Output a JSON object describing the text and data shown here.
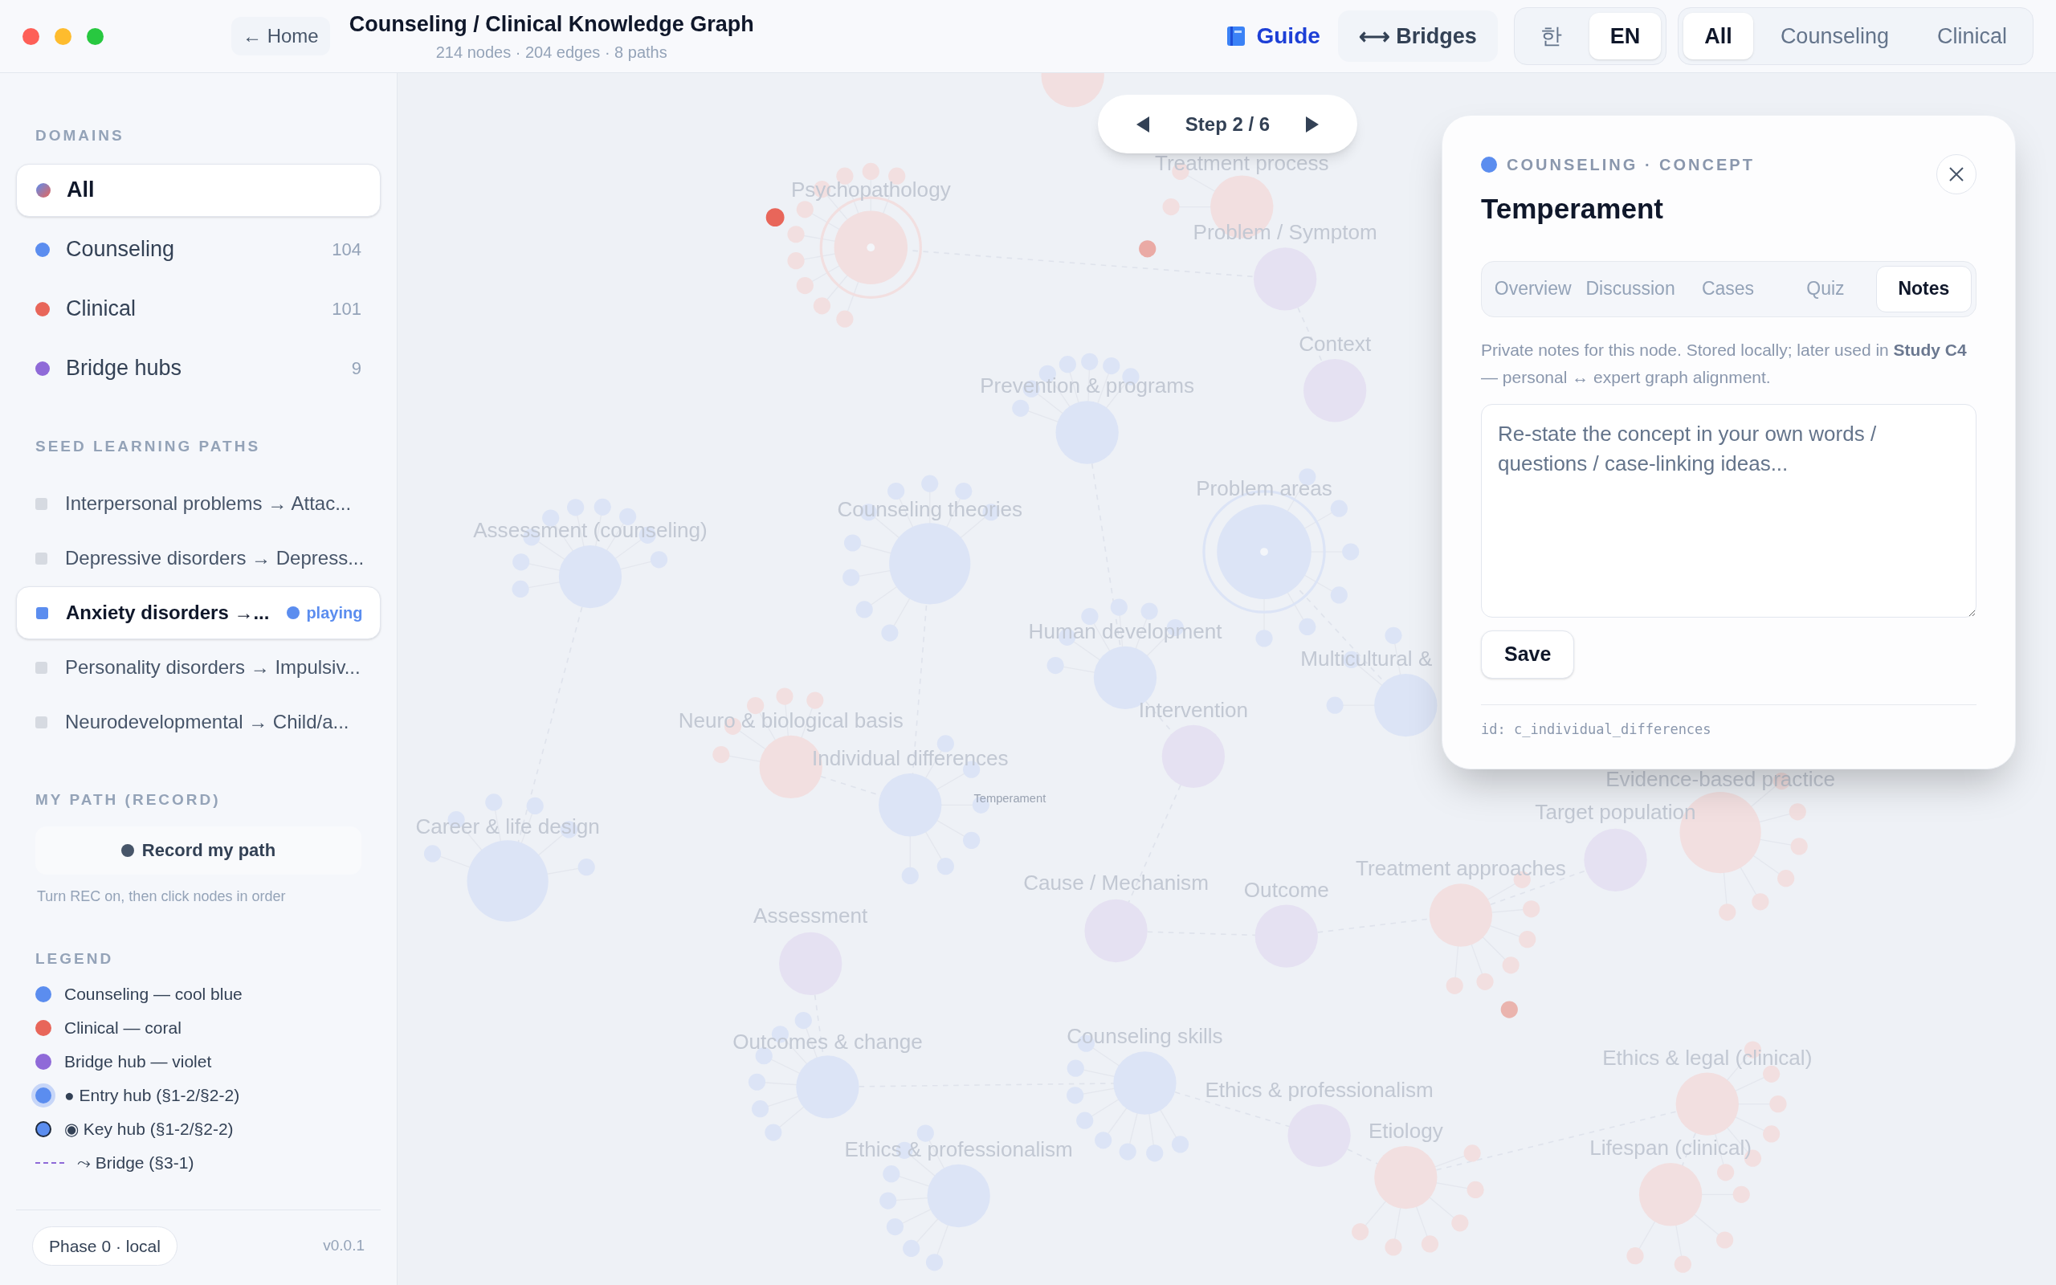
{
  "window": {
    "title": "Counseling / Clinical Knowledge Graph",
    "subtitle": "214 nodes · 204 edges · 8 paths"
  },
  "top_bar": {
    "home": "← Home",
    "guide": "Guide",
    "bridges": "⟷ Bridges",
    "languages": [
      {
        "label": "한",
        "selected": false
      },
      {
        "label": "EN",
        "selected": true
      }
    ],
    "filters": [
      {
        "label": "All",
        "selected": true
      },
      {
        "label": "Counseling",
        "selected": false
      },
      {
        "label": "Clinical",
        "selected": false
      }
    ]
  },
  "sidebar": {
    "domains_heading": "DOMAINS",
    "domains": [
      {
        "label": "All",
        "selected": true
      },
      {
        "label": "Counseling",
        "count": "104",
        "color": "#5b8def",
        "selected": false
      },
      {
        "label": "Clinical",
        "count": "101",
        "color": "#e8665a",
        "selected": false
      },
      {
        "label": "Bridge hubs",
        "count": "9",
        "color": "#8f6ad8",
        "selected": false
      }
    ],
    "paths_heading": "SEED LEARNING PATHS",
    "paths": [
      {
        "label": "Interpersonal problems → Attac...",
        "selected": false
      },
      {
        "label": "Depressive disorders → Depress...",
        "selected": false
      },
      {
        "label": "Anxiety disorders →...",
        "selected": true,
        "badge": "playing"
      },
      {
        "label": "Personality disorders → Impulsiv...",
        "selected": false
      },
      {
        "label": "Neurodevelopmental → Child/a...",
        "selected": false
      }
    ],
    "record_heading": "MY PATH (RECORD)",
    "record_button": "Record my path",
    "record_hint": "Turn REC on, then click nodes in order",
    "legend_heading": "LEGEND",
    "legend": [
      {
        "kind": "dot",
        "color": "#5b8def",
        "label": "Counseling — cool blue"
      },
      {
        "kind": "dot",
        "color": "#e8665a",
        "label": "Clinical — coral"
      },
      {
        "kind": "dot",
        "color": "#8f6ad8",
        "label": "Bridge hub — violet"
      },
      {
        "kind": "entry",
        "color": "#5b8def",
        "label": "● Entry hub (§1-2/§2-2)"
      },
      {
        "kind": "key",
        "color": "#5b8def",
        "label": "◉ Key hub (§1-2/§2-2)"
      },
      {
        "kind": "dashed",
        "color": "#8f6ad8",
        "label": "⤳ Bridge (§3-1)"
      }
    ],
    "phase": "Phase 0 · local",
    "version": "v0.0.1"
  },
  "graph": {
    "step": "Step 2 / 6",
    "nodes": [
      {
        "kind": "ring",
        "color": "#f2dfe0",
        "label": "Psychopathology"
      },
      {
        "kind": "hub",
        "color": "#f2dfe0",
        "label": "Treatment process"
      },
      {
        "kind": "hub",
        "color": "#e5e1f2",
        "label": "Problem / Symptom"
      },
      {
        "kind": "hub",
        "color": "#e5e1f2",
        "label": "Context"
      },
      {
        "kind": "hub",
        "color": "#dce4f6",
        "label": "Prevention & programs"
      },
      {
        "kind": "hub",
        "color": "#dce4f6",
        "label": "Assessment (counseling)"
      },
      {
        "kind": "hub",
        "color": "#dce4f6",
        "label": "Counseling theories"
      },
      {
        "kind": "ring",
        "color": "#dce4f6",
        "label": "Problem areas"
      },
      {
        "kind": "hub",
        "color": "#dce4f6",
        "label": "Human development"
      },
      {
        "kind": "hub",
        "color": "#dce4f6",
        "label": "Multicultural &"
      },
      {
        "kind": "hub",
        "color": "#e5e1f2",
        "label": "Intervention"
      },
      {
        "kind": "hub",
        "color": "#f2dfe0",
        "label": "Neuro & biological basis"
      },
      {
        "kind": "hub",
        "color": "#dce4f6",
        "label": "Individual differences"
      },
      {
        "kind": "label",
        "label": "Temperament"
      },
      {
        "kind": "hub",
        "color": "#dce4f6",
        "label": "Career & life design"
      },
      {
        "kind": "hub",
        "color": "#e5e1f2",
        "label": "Assessment"
      },
      {
        "kind": "hub",
        "color": "#e5e1f2",
        "label": "Cause / Mechanism"
      },
      {
        "kind": "hub",
        "color": "#e5e1f2",
        "label": "Outcome"
      },
      {
        "kind": "hub",
        "color": "#f2dfe0",
        "label": "Treatment approaches"
      },
      {
        "kind": "hub",
        "color": "#e5e1f2",
        "label": "Target population"
      },
      {
        "kind": "hub",
        "color": "#f2dfe0",
        "label": "Evidence-based practice"
      },
      {
        "kind": "hub",
        "color": "#dce4f6",
        "label": "Outcomes & change"
      },
      {
        "kind": "hub",
        "color": "#dce4f6",
        "label": "Counseling skills"
      },
      {
        "kind": "hub",
        "color": "#e5e1f2",
        "label": "Ethics & professionalism"
      },
      {
        "kind": "hub",
        "color": "#f2dfe0",
        "label": "Etiology"
      },
      {
        "kind": "hub",
        "color": "#f2dfe0",
        "label": "Ethics & legal (clinical)"
      },
      {
        "kind": "hub",
        "color": "#f2dfe0",
        "label": "Lifespan (clinical)"
      },
      {
        "kind": "hub",
        "color": "#dce4f6",
        "label": "Ethics & professionalism"
      }
    ]
  },
  "panel": {
    "meta": "COUNSELING · CONCEPT",
    "color": "#5b8def",
    "title": "Temperament",
    "tabs": [
      {
        "label": "Overview",
        "selected": false
      },
      {
        "label": "Discussion",
        "selected": false
      },
      {
        "label": "Cases",
        "selected": false
      },
      {
        "label": "Quiz",
        "selected": false
      },
      {
        "label": "Notes",
        "selected": true
      }
    ],
    "note": "Private notes for this node. Stored locally; later used in **Study C4** — personal ↔ expert graph alignment.",
    "placeholder": "Re-state the concept in your own words / questions / case-linking ideas...",
    "save": "Save",
    "id": "id: c_individual_differences"
  }
}
